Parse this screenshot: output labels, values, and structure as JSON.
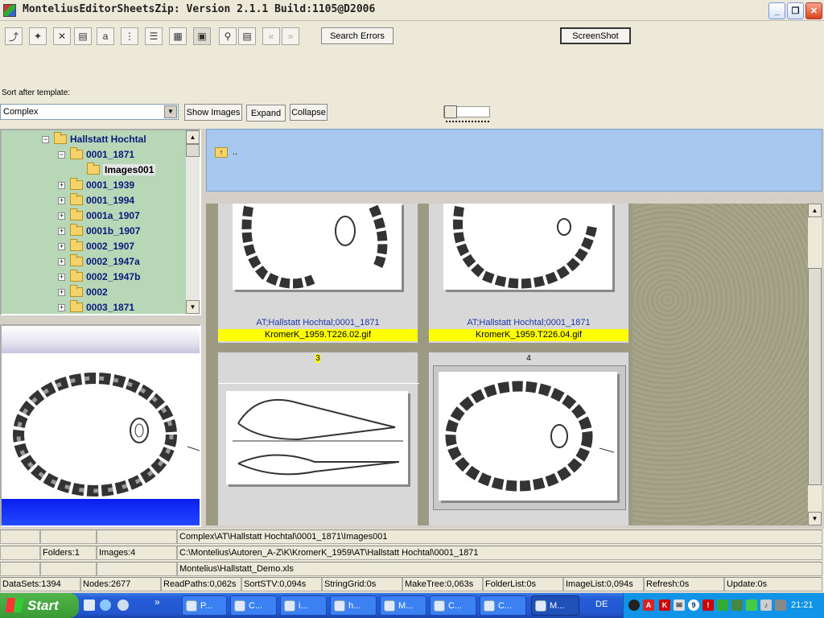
{
  "window": {
    "title": "MonteliusEditorSheetsZip: Version  2.1.1 Build:1105@D2006",
    "controls": {
      "minimize": "_",
      "maximize": "❐",
      "close": "✕"
    }
  },
  "toolbar": {
    "search_errors_label": "Search Errors",
    "screenshot_label": "ScreenShot",
    "sort_label": "Sort after template:",
    "sort_value": "Complex",
    "show_images_label": "Show Images",
    "expand_label": "Expand",
    "collapse_label": "Collapse"
  },
  "tree": {
    "root": "Hallstatt Hochtal",
    "items": [
      {
        "label": "0001_1871",
        "expanded": true
      },
      {
        "label": "Images001",
        "selected": true
      },
      {
        "label": "0001_1939"
      },
      {
        "label": "0001_1994"
      },
      {
        "label": "0001a_1907"
      },
      {
        "label": "0001b_1907"
      },
      {
        "label": "0002_1907"
      },
      {
        "label": "0002_1947a"
      },
      {
        "label": "0002_1947b"
      },
      {
        "label": "0002"
      },
      {
        "label": "0003_1871"
      }
    ]
  },
  "path_header": {
    "up_label": ".."
  },
  "grid": {
    "cards": [
      {
        "location": "AT;Hallstatt Hochtal;0001_1871",
        "file": "KromerK_1959.T226.02.gif"
      },
      {
        "location": "AT;Hallstatt Hochtal;0001_1871",
        "file": "KromerK_1959.T226.04.gif"
      },
      {
        "number": "3"
      },
      {
        "number": "4"
      }
    ]
  },
  "status": {
    "row1": {
      "path": "Complex\\AT\\Hallstatt Hochtal\\0001_1871\\Images001"
    },
    "row2": {
      "folders": "Folders:1",
      "images": "Images:4",
      "path": "C:\\Montelius\\Autoren_A-Z\\K\\KromerK_1959\\AT\\Hallstatt Hochtal\\0001_1871"
    },
    "row3": {
      "file": "Montelius\\Hallstatt_Demo.xls"
    },
    "stats": [
      "DataSets:1394",
      "Nodes:2677",
      "ReadPaths:0,062s",
      "SortSTV:0,094s",
      "StringGrid:0s",
      "MakeTree:0,063s",
      "FolderList:0s",
      "ImageList:0,094s",
      "Refresh:0s",
      "Update:0s"
    ]
  },
  "taskbar": {
    "start_label": "Start",
    "tasks": [
      "P...",
      "C...",
      "i...",
      "h...",
      "M...",
      "C...",
      "C...",
      "M..."
    ],
    "lang": "DE",
    "clock": "21:21"
  },
  "colors": {
    "tree_bg": "#b8d7b7",
    "header_bg": "#a6c8ef",
    "highlight": "#ffff00"
  }
}
